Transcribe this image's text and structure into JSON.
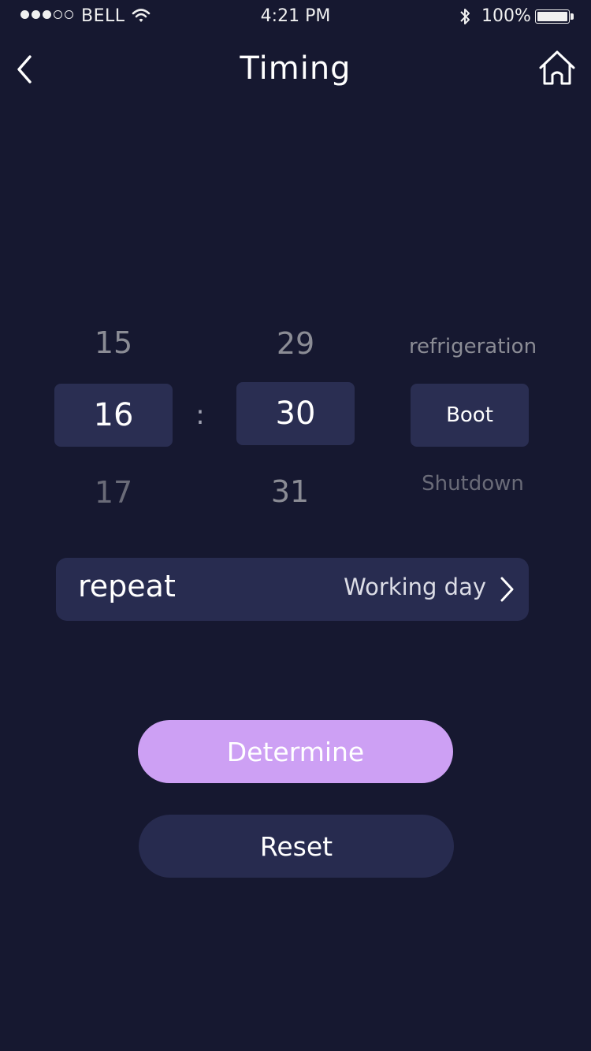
{
  "status_bar": {
    "carrier": "BELL",
    "time": "4:21 PM",
    "battery_percent": "100%",
    "signal_strength": 3,
    "signal_total": 5,
    "icons": [
      "wifi-icon",
      "bluetooth-icon",
      "battery-icon"
    ]
  },
  "nav": {
    "title": "Timing",
    "back_icon": "chevron-left-icon",
    "home_icon": "home-icon"
  },
  "picker": {
    "hour": {
      "prev": "15",
      "selected": "16",
      "next": "17"
    },
    "separator": ":",
    "minute": {
      "prev": "29",
      "selected": "30",
      "next": "31"
    },
    "mode": {
      "prev": "refrigeration",
      "selected": "Boot",
      "next": "Shutdown"
    }
  },
  "repeat": {
    "label": "repeat",
    "value": "Working day",
    "icon": "chevron-right-icon"
  },
  "actions": {
    "determine_label": "Determine",
    "reset_label": "Reset"
  },
  "colors": {
    "background": "#161830",
    "surface": "#2a2e52",
    "accent": "#cda0f4",
    "text_primary": "#ffffff",
    "text_muted": "#8b8c95"
  }
}
